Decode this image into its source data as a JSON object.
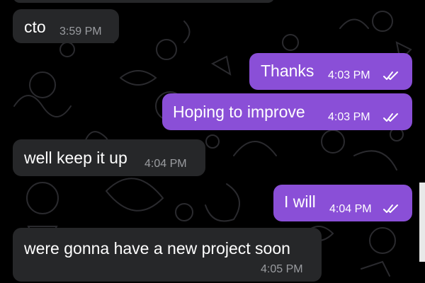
{
  "messages": [
    {
      "text": "cto",
      "time": "3:59 PM",
      "direction": "incoming"
    },
    {
      "text": "Thanks",
      "time": "4:03 PM",
      "direction": "outgoing",
      "status": "read"
    },
    {
      "text": "Hoping to improve",
      "time": "4:03 PM",
      "direction": "outgoing",
      "status": "read"
    },
    {
      "text": "well keep it up",
      "time": "4:04 PM",
      "direction": "incoming"
    },
    {
      "text": "I will",
      "time": "4:04 PM",
      "direction": "outgoing",
      "status": "read"
    },
    {
      "text": "were gonna have a new project soon",
      "time": "4:05 PM",
      "direction": "incoming"
    }
  ],
  "colors": {
    "background": "#000000",
    "incoming_bubble": "#262729",
    "outgoing_bubble": "#8a4fd7",
    "doodle": "#2a2a2e"
  },
  "icons": {
    "read_status": "double-check-icon"
  }
}
